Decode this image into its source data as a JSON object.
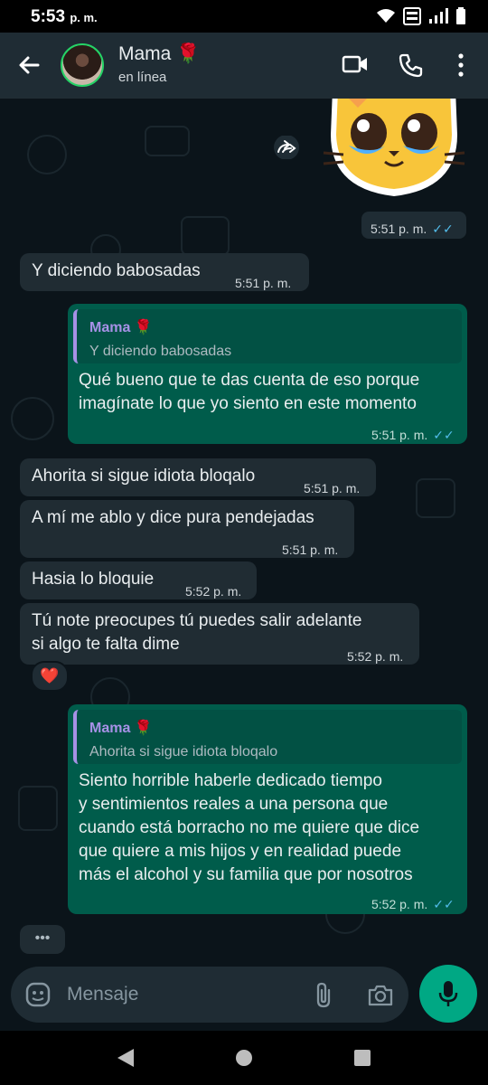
{
  "status_bar": {
    "time": "5:53",
    "time_suffix": "p. m."
  },
  "header": {
    "name": "Mama 🌹",
    "status": "en línea"
  },
  "messages": [
    {
      "kind": "sticker",
      "time": "5:51 p. m."
    },
    {
      "kind": "in",
      "text": "Y diciendo babosadas",
      "time": "5:51 p. m."
    },
    {
      "kind": "out",
      "quote_name": "Mama 🌹",
      "quote_text": "Y diciendo babosadas",
      "lines": [
        "Qué bueno que te das cuenta de eso porque",
        "imagínate lo que yo siento en este momento"
      ],
      "time": "5:51 p. m."
    },
    {
      "kind": "in",
      "text": "Ahorita si sigue idiota  bloqalo",
      "time": "5:51 p. m."
    },
    {
      "kind": "in",
      "text": "A mí me ablo y dice pura pendejadas",
      "time": "5:51 p. m."
    },
    {
      "kind": "in",
      "text": "Hasia lo bloquie",
      "time": "5:52 p. m."
    },
    {
      "kind": "in",
      "lines": [
        "Tú note preocupes tú puedes salir adelante",
        "si algo te falta dime"
      ],
      "time": "5:52 p. m.",
      "reaction": "❤️"
    },
    {
      "kind": "out",
      "quote_name": "Mama 🌹",
      "quote_text": "Ahorita si sigue idiota  bloqalo",
      "lines": [
        "Siento horrible haberle dedicado tiempo",
        "y sentimientos reales a una persona que",
        "cuando está borracho no me quiere que dice",
        "que quiere a mis hijos y en realidad puede",
        "más el alcohol y su familia que por nosotros"
      ],
      "time": "5:52 p. m."
    }
  ],
  "typing_indicator": "•••",
  "composer": {
    "placeholder": "Mensaje"
  },
  "colors": {
    "incoming": "#202c33",
    "outgoing": "#005c4b",
    "accent": "#00a884",
    "read_ticks": "#53bdeb"
  }
}
